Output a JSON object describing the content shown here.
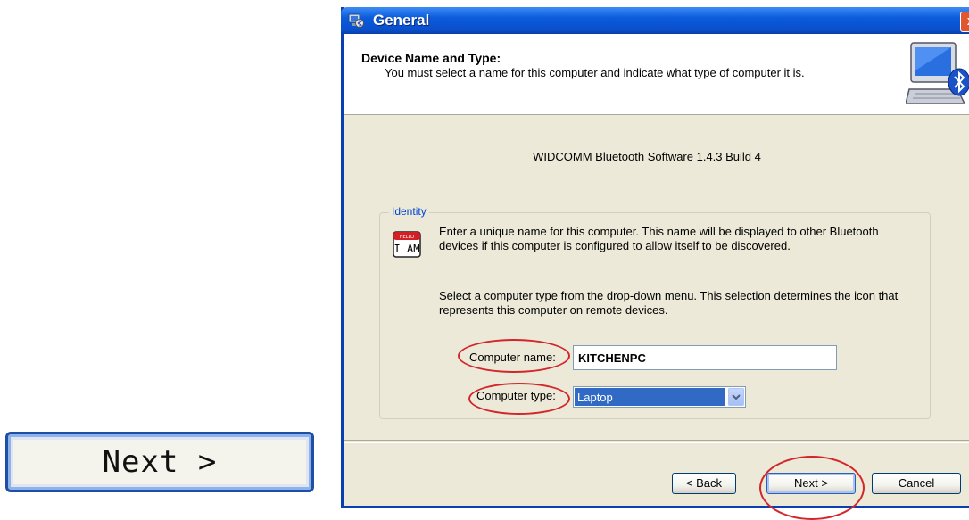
{
  "zoomed_button": {
    "label": "Next >"
  },
  "window": {
    "title": "General",
    "close_label": "x"
  },
  "header": {
    "title": "Device Name and Type:",
    "subtitle": "You must select a name for this computer and indicate what type of computer it is."
  },
  "main": {
    "build_info": "WIDCOMM Bluetooth Software 1.4.3 Build 4",
    "identity": {
      "legend": "Identity",
      "icon_text_top": "HELLO",
      "icon_text_bottom": "I AM",
      "description_name": "Enter a unique name for this computer.  This name will be displayed to other Bluetooth devices if this computer is configured to allow itself to be discovered.",
      "description_type": "Select a computer type from the drop-down menu.  This selection determines the icon that represents this computer on remote devices.",
      "computer_name_label": "Computer name:",
      "computer_name_value": "KITCHENPC",
      "computer_type_label": "Computer type:",
      "computer_type_value": "Laptop"
    }
  },
  "footer": {
    "back_label": "< Back",
    "next_label": "Next >",
    "cancel_label": "Cancel"
  },
  "colors": {
    "titlebar": "#0a4fcc",
    "dialog_bg": "#ece9d8",
    "annotation": "#d3262b",
    "selection": "#316ac5"
  }
}
